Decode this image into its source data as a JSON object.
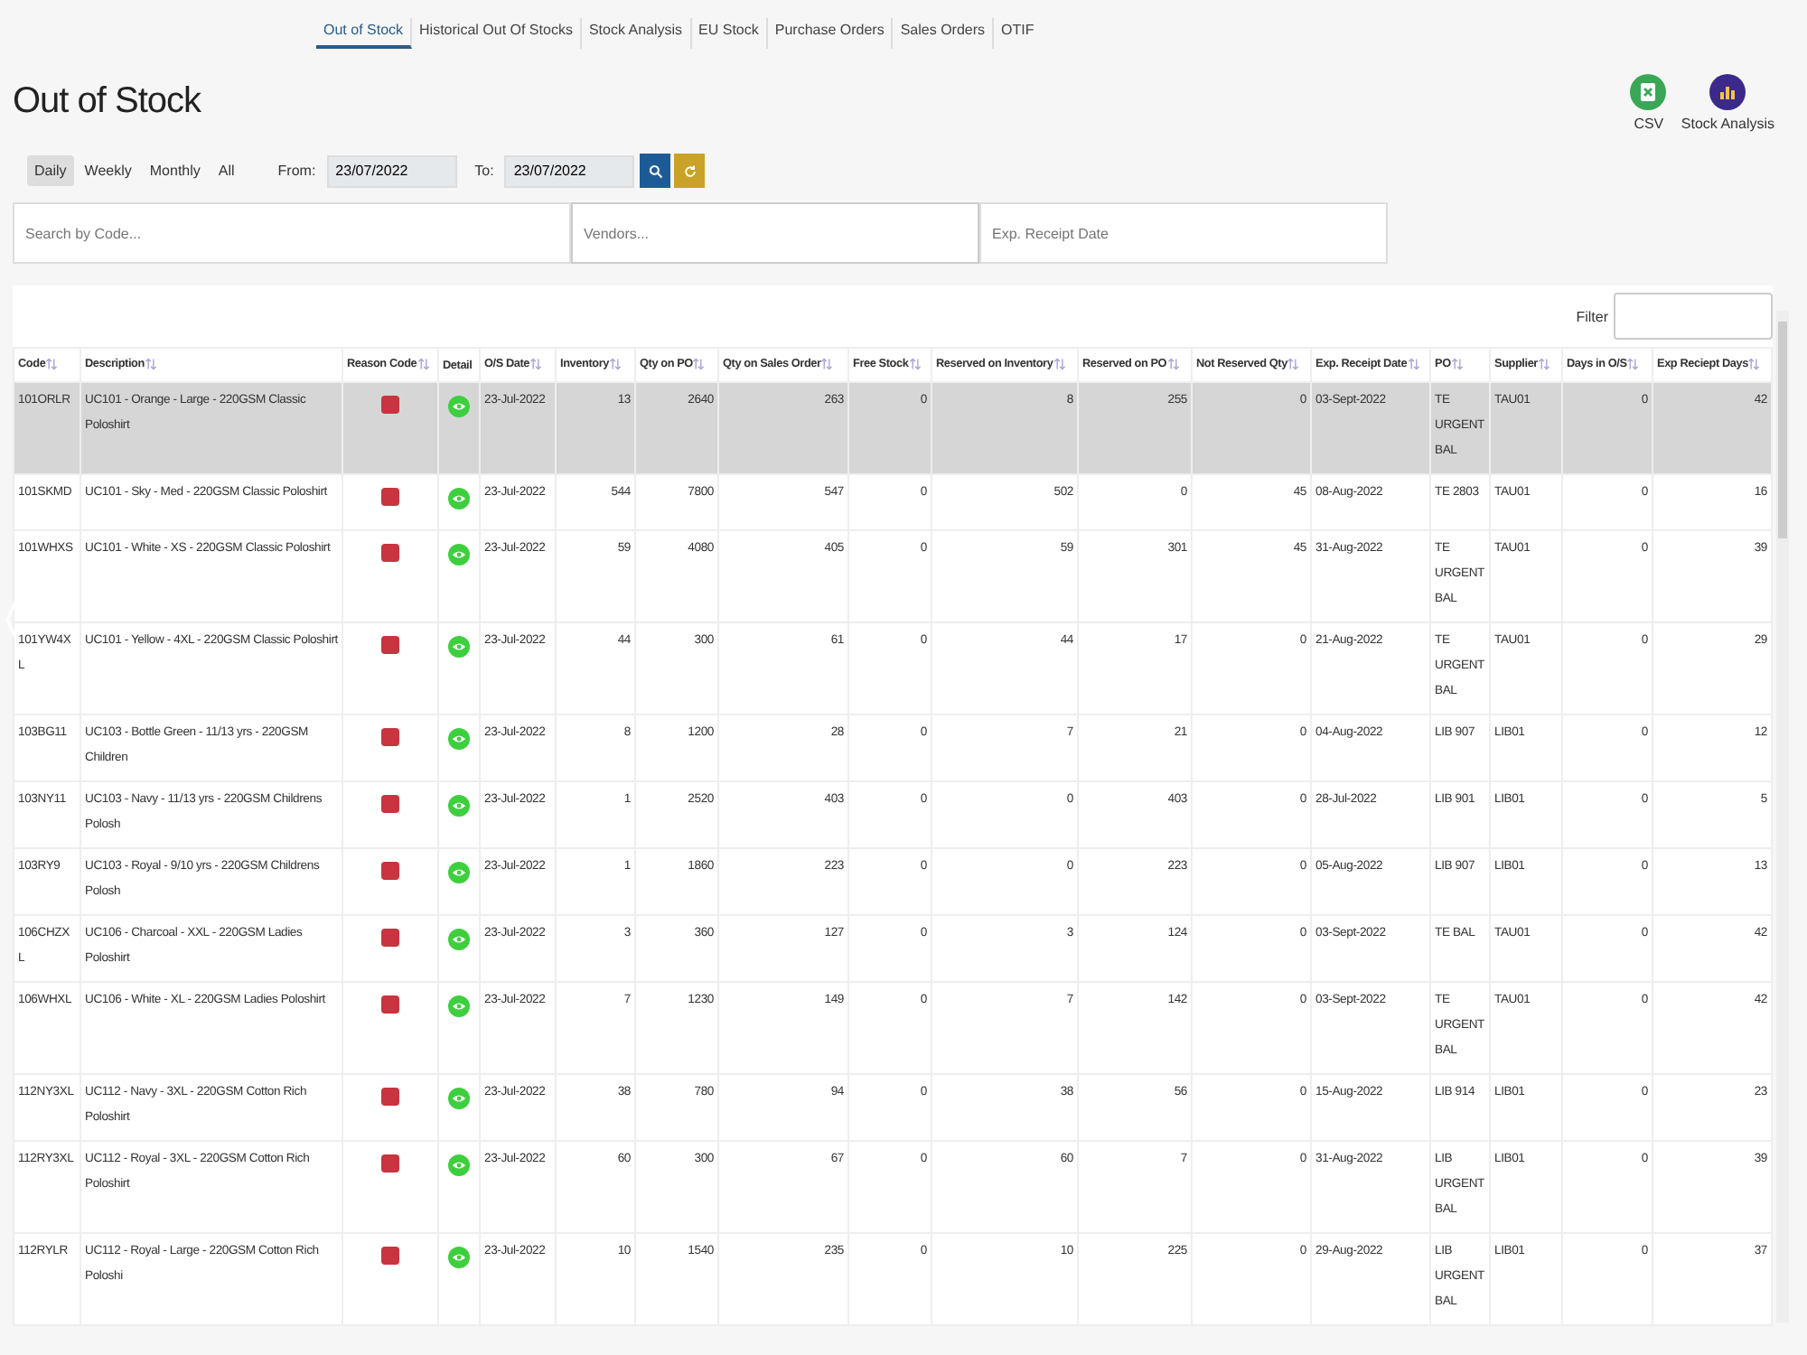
{
  "nav_tabs": [
    {
      "label": "Out of Stock",
      "selected": true
    },
    {
      "label": "Historical Out Of Stocks",
      "selected": false
    },
    {
      "label": "Stock Analysis",
      "selected": false
    },
    {
      "label": "EU Stock",
      "selected": false
    },
    {
      "label": "Purchase Orders",
      "selected": false
    },
    {
      "label": "Sales Orders",
      "selected": false
    },
    {
      "label": "OTIF",
      "selected": false
    }
  ],
  "page_title": "Out of Stock",
  "actions": [
    {
      "label": "CSV",
      "kind": "csv"
    },
    {
      "label": "Stock Analysis",
      "kind": "analysis"
    }
  ],
  "periods": [
    {
      "label": "Daily",
      "selected": true
    },
    {
      "label": "Weekly",
      "selected": false
    },
    {
      "label": "Monthly",
      "selected": false
    },
    {
      "label": "All",
      "selected": false
    }
  ],
  "from": {
    "label": "From:",
    "value": "23/07/2022"
  },
  "to": {
    "label": "To:",
    "value": "23/07/2022"
  },
  "search_fields": [
    {
      "placeholder": "Search by Code..."
    },
    {
      "placeholder": "Vendors..."
    },
    {
      "placeholder": "Exp. Receipt Date"
    }
  ],
  "filter": {
    "label": "Filter"
  },
  "table": {
    "columns": [
      {
        "label": "Code",
        "kind": "text"
      },
      {
        "label": "Description",
        "kind": "text"
      },
      {
        "label": "Reason Code",
        "kind": "reason"
      },
      {
        "label": "Detail",
        "kind": "detail"
      },
      {
        "label": "O/S Date",
        "kind": "text"
      },
      {
        "label": "Inventory",
        "kind": "number"
      },
      {
        "label": "Qty on PO",
        "kind": "number"
      },
      {
        "label": "Qty on Sales Order",
        "kind": "number"
      },
      {
        "label": "Free Stock",
        "kind": "number"
      },
      {
        "label": "Reserved on Inventory",
        "kind": "number"
      },
      {
        "label": "Reserved on PO",
        "kind": "number"
      },
      {
        "label": "Not Reserved Qty",
        "kind": "number"
      },
      {
        "label": "Exp. Receipt Date",
        "kind": "text"
      },
      {
        "label": "PO",
        "kind": "text"
      },
      {
        "label": "Supplier",
        "kind": "text"
      },
      {
        "label": "Days in O/S",
        "kind": "number"
      },
      {
        "label": "Exp Reciept Days",
        "kind": "number"
      }
    ],
    "rows": [
      {
        "selected": true,
        "cells": [
          "101ORLR",
          "UC101 - Orange - Large - 220GSM Classic Poloshirt",
          "",
          "",
          "23-Jul-2022",
          "13",
          "2640",
          "263",
          "0",
          "8",
          "255",
          "0",
          "03-Sept-2022",
          "TE URGENT BAL",
          "TAU01",
          "0",
          "42"
        ]
      },
      {
        "selected": false,
        "cells": [
          "101SKMD",
          "UC101 - Sky - Med - 220GSM Classic Poloshirt",
          "",
          "",
          "23-Jul-2022",
          "544",
          "7800",
          "547",
          "0",
          "502",
          "0",
          "45",
          "08-Aug-2022",
          "TE 2803",
          "TAU01",
          "0",
          "16"
        ]
      },
      {
        "selected": false,
        "cells": [
          "101WHXS",
          "UC101 - White - XS - 220GSM Classic Poloshirt",
          "",
          "",
          "23-Jul-2022",
          "59",
          "4080",
          "405",
          "0",
          "59",
          "301",
          "45",
          "31-Aug-2022",
          "TE URGENT BAL",
          "TAU01",
          "0",
          "39"
        ]
      },
      {
        "selected": false,
        "cells": [
          "101YW4XL",
          "UC101 - Yellow - 4XL - 220GSM Classic Poloshirt",
          "",
          "",
          "23-Jul-2022",
          "44",
          "300",
          "61",
          "0",
          "44",
          "17",
          "0",
          "21-Aug-2022",
          "TE URGENT BAL",
          "TAU01",
          "0",
          "29"
        ]
      },
      {
        "selected": false,
        "cells": [
          "103BG11",
          "UC103 - Bottle Green - 11/13 yrs - 220GSM Children",
          "",
          "",
          "23-Jul-2022",
          "8",
          "1200",
          "28",
          "0",
          "7",
          "21",
          "0",
          "04-Aug-2022",
          "LIB 907",
          "LIB01",
          "0",
          "12"
        ]
      },
      {
        "selected": false,
        "cells": [
          "103NY11",
          "UC103 - Navy - 11/13 yrs - 220GSM Childrens Polosh",
          "",
          "",
          "23-Jul-2022",
          "1",
          "2520",
          "403",
          "0",
          "0",
          "403",
          "0",
          "28-Jul-2022",
          "LIB 901",
          "LIB01",
          "0",
          "5"
        ]
      },
      {
        "selected": false,
        "cells": [
          "103RY9",
          "UC103 - Royal - 9/10 yrs - 220GSM Childrens Polosh",
          "",
          "",
          "23-Jul-2022",
          "1",
          "1860",
          "223",
          "0",
          "0",
          "223",
          "0",
          "05-Aug-2022",
          "LIB 907",
          "LIB01",
          "0",
          "13"
        ]
      },
      {
        "selected": false,
        "cells": [
          "106CHZXL",
          "UC106 - Charcoal - XXL - 220GSM Ladies Poloshirt",
          "",
          "",
          "23-Jul-2022",
          "3",
          "360",
          "127",
          "0",
          "3",
          "124",
          "0",
          "03-Sept-2022",
          "TE BAL",
          "TAU01",
          "0",
          "42"
        ]
      },
      {
        "selected": false,
        "cells": [
          "106WHXL",
          "UC106 - White - XL - 220GSM Ladies Poloshirt",
          "",
          "",
          "23-Jul-2022",
          "7",
          "1230",
          "149",
          "0",
          "7",
          "142",
          "0",
          "03-Sept-2022",
          "TE URGENT BAL",
          "TAU01",
          "0",
          "42"
        ]
      },
      {
        "selected": false,
        "cells": [
          "112NY3XL",
          "UC112 - Navy - 3XL - 220GSM Cotton Rich Poloshirt",
          "",
          "",
          "23-Jul-2022",
          "38",
          "780",
          "94",
          "0",
          "38",
          "56",
          "0",
          "15-Aug-2022",
          "LIB 914",
          "LIB01",
          "0",
          "23"
        ]
      },
      {
        "selected": false,
        "cells": [
          "112RY3XL",
          "UC112 - Royal - 3XL - 220GSM Cotton Rich Poloshirt",
          "",
          "",
          "23-Jul-2022",
          "60",
          "300",
          "67",
          "0",
          "60",
          "7",
          "0",
          "31-Aug-2022",
          "LIB URGENT BAL",
          "LIB01",
          "0",
          "39"
        ]
      },
      {
        "selected": false,
        "cells": [
          "112RYLR",
          "UC112 - Royal - Large - 220GSM Cotton Rich Poloshi",
          "",
          "",
          "23-Jul-2022",
          "10",
          "1540",
          "235",
          "0",
          "10",
          "225",
          "0",
          "29-Aug-2022",
          "LIB URGENT BAL",
          "LIB01",
          "0",
          "37"
        ]
      }
    ]
  }
}
